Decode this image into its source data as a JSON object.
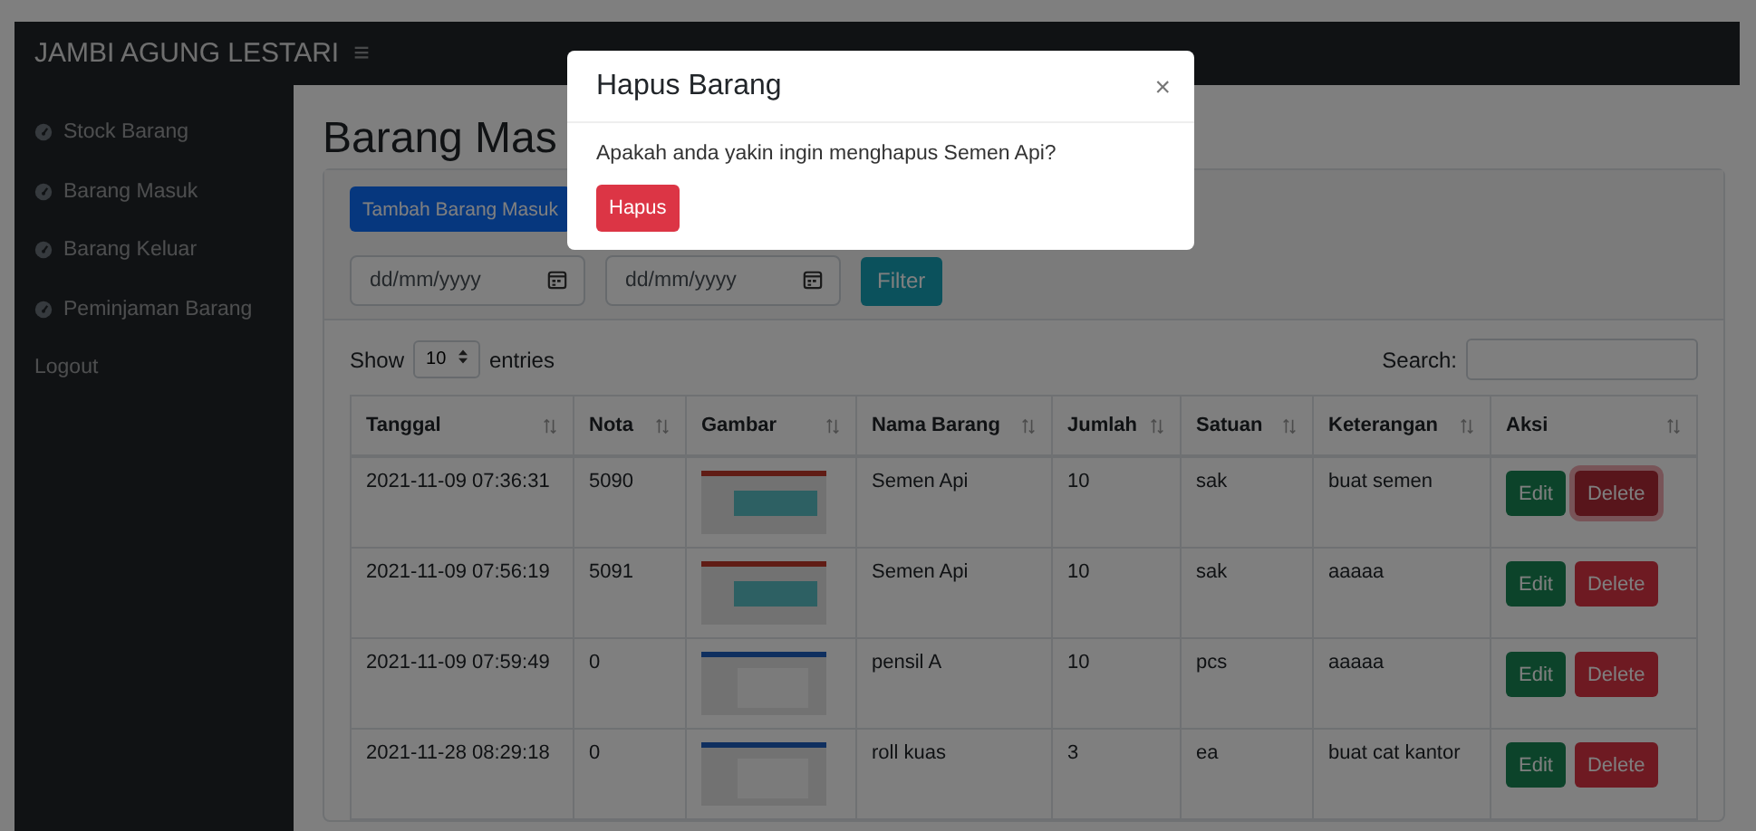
{
  "navbar": {
    "brand": "JAMBI AGUNG LESTARI",
    "menu_icon": "≡"
  },
  "sidebar": {
    "items": [
      {
        "label": "Stock Barang",
        "kind": "link"
      },
      {
        "label": "Barang Masuk",
        "kind": "link"
      },
      {
        "label": "Barang Keluar",
        "kind": "link"
      },
      {
        "label": "Peminjaman Barang",
        "kind": "link"
      },
      {
        "label": "Logout",
        "kind": "plain"
      }
    ]
  },
  "page": {
    "title": "Barang Mas"
  },
  "toolbar": {
    "add_button": "Tambah Barang Masuk",
    "date_from": {
      "placeholder": "dd/mm/yyyy"
    },
    "date_to": {
      "placeholder": "dd/mm/yyyy"
    },
    "filter_button": "Filter"
  },
  "table_controls": {
    "show_label": "Show",
    "page_size": "10",
    "entries_label": "entries",
    "search_label": "Search:"
  },
  "table": {
    "columns": [
      "Tanggal",
      "Nota",
      "Gambar",
      "Nama Barang",
      "Jumlah",
      "Satuan",
      "Keterangan",
      "Aksi"
    ],
    "rows": [
      {
        "tanggal": "2021-11-09 07:36:31",
        "nota": "5090",
        "kind": "slide",
        "nama_barang": "Semen Api",
        "jumlah": "10",
        "satuan": "sak",
        "keterangan": "buat semen",
        "edit": "Edit",
        "delete": "Delete",
        "delete_focused": true
      },
      {
        "tanggal": "2021-11-09 07:56:19",
        "nota": "5091",
        "kind": "slide",
        "nama_barang": "Semen Api",
        "jumlah": "10",
        "satuan": "sak",
        "keterangan": "aaaaa",
        "edit": "Edit",
        "delete": "Delete",
        "delete_focused": false
      },
      {
        "tanggal": "2021-11-09 07:59:49",
        "nota": "0",
        "kind": "document",
        "nama_barang": "pensil A",
        "jumlah": "10",
        "satuan": "pcs",
        "keterangan": "aaaaa",
        "edit": "Edit",
        "delete": "Delete",
        "delete_focused": false
      },
      {
        "tanggal": "2021-11-28 08:29:18",
        "nota": "0",
        "kind": "document",
        "nama_barang": "roll kuas",
        "jumlah": "3",
        "satuan": "ea",
        "keterangan": "buat cat kantor",
        "edit": "Edit",
        "delete": "Delete",
        "delete_focused": false
      }
    ]
  },
  "modal": {
    "title": "Hapus Barang",
    "close": "×",
    "message": "Apakah anda yakin ingin menghapus Semen Api?",
    "confirm_button": "Hapus"
  }
}
